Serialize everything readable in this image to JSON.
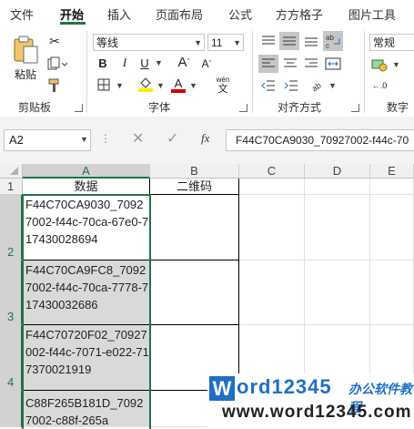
{
  "menu_tabs": [
    "文件",
    "开始",
    "插入",
    "页面布局",
    "公式",
    "方方格子",
    "图片工具"
  ],
  "clipboard": {
    "paste_label": "粘贴",
    "group_label": "剪贴板"
  },
  "font": {
    "name": "等线",
    "size": "11",
    "group_label": "字体",
    "bold": "B",
    "italic": "I",
    "underline": "U",
    "grow": "A",
    "shrink": "A",
    "phonetic": "wén",
    "font_color": "#d40000",
    "fill_color": "#ffee00"
  },
  "alignment": {
    "group_label": "对齐方式"
  },
  "number": {
    "format": "常规",
    "group_label": "数字"
  },
  "formula_bar": {
    "name_box": "A2",
    "fx": "fx",
    "value": "F44C70CA9030_70927002-f44c-70"
  },
  "columns": [
    "A",
    "B",
    "C",
    "D",
    "E"
  ],
  "rows": [
    {
      "num": "1",
      "a": "数据",
      "b": "二维码"
    },
    {
      "num": "2",
      "a": "F44C70CA9030_70927002-f44c-70ca-67e0-717430028694",
      "b": ""
    },
    {
      "num": "3",
      "a": "F44C70CA9FC8_70927002-f44c-70ca-7778-717430032686",
      "b": ""
    },
    {
      "num": "4",
      "a": "F44C70720F02_70927002-f44c-7071-e022-717370021919",
      "b": ""
    },
    {
      "num": "",
      "a": "C88F265B181D_70927002-c88f-265a",
      "b": ""
    }
  ],
  "watermark": {
    "brand_w": "W",
    "brand_rest": "ord12345",
    "tagline": "办公软件教程",
    "url": "www.word12345.com"
  }
}
